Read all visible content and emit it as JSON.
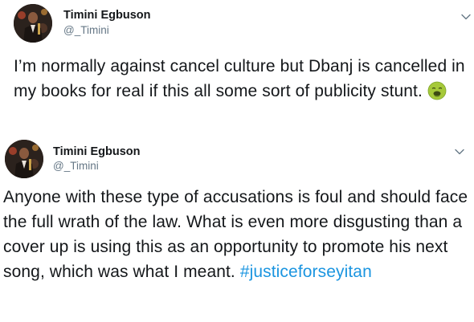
{
  "tweets": [
    {
      "author_name": "Timini Egbuson",
      "author_handle": "@_Timini",
      "text": "I’m normally against cancel culture but Dbanj is cancelled in my books for real if this all some sort of publicity stunt.",
      "emoji": "nauseated-face-emoji",
      "menu_icon": "chevron-down-icon"
    },
    {
      "author_name": "Timini Egbuson",
      "author_handle": "@_Timini",
      "text": "Anyone with these type of accusations is foul and should face the full wrath of the law. What is even more disgusting than a cover up is using this as an opportunity to promote his next song, which was what I meant.",
      "hashtag": "#justiceforseyitan",
      "menu_icon": "chevron-down-icon"
    }
  ],
  "colors": {
    "text": "#14171a",
    "handle": "#657786",
    "hashtag": "#1b95e0",
    "chevron": "#657786",
    "background": "#ffffff"
  }
}
